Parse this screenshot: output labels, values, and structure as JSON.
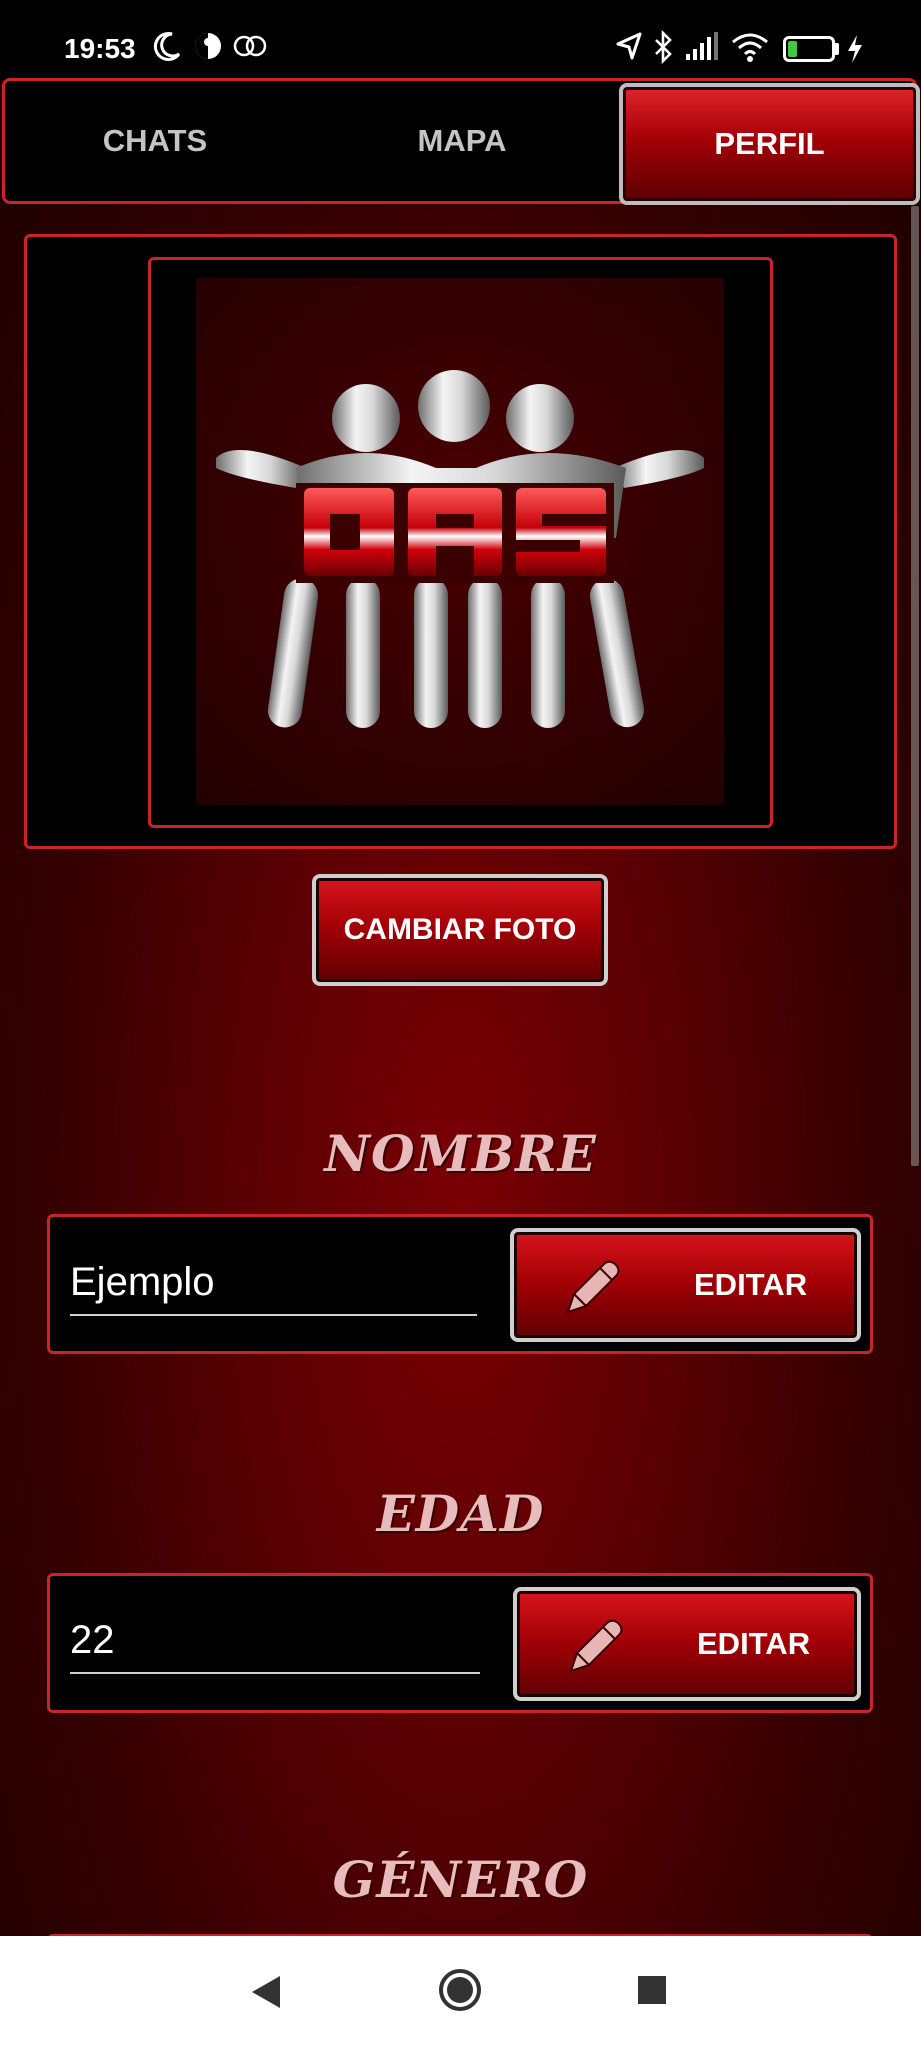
{
  "status_bar": {
    "time": "19:53",
    "battery_level": "20",
    "icons": [
      "moon-icon",
      "data-saver-icon",
      "dual-sim-icon",
      "location-arrow-icon",
      "bluetooth-icon",
      "signal-icon",
      "wifi-icon",
      "battery-icon",
      "charging-icon"
    ]
  },
  "tabs": [
    {
      "label": "CHATS",
      "active": false
    },
    {
      "label": "MAPA",
      "active": false
    },
    {
      "label": "PERFIL",
      "active": true
    }
  ],
  "profile": {
    "logo_text": "DAS",
    "change_photo_label": "CAMBIAR FOTO",
    "fields": [
      {
        "title": "NOMBRE",
        "value": "Ejemplo",
        "button_label": "EDITAR"
      },
      {
        "title": "EDAD",
        "value": "22",
        "button_label": "EDITAR"
      },
      {
        "title": "GÉNERO"
      }
    ]
  },
  "colors": {
    "accent": "#c8242a",
    "background_dark": "#1a0000",
    "background_glow": "#7a0004",
    "title_text": "#e8bcbc"
  },
  "nav_bar": {
    "buttons": [
      "back-icon",
      "home-icon",
      "recents-icon"
    ]
  }
}
